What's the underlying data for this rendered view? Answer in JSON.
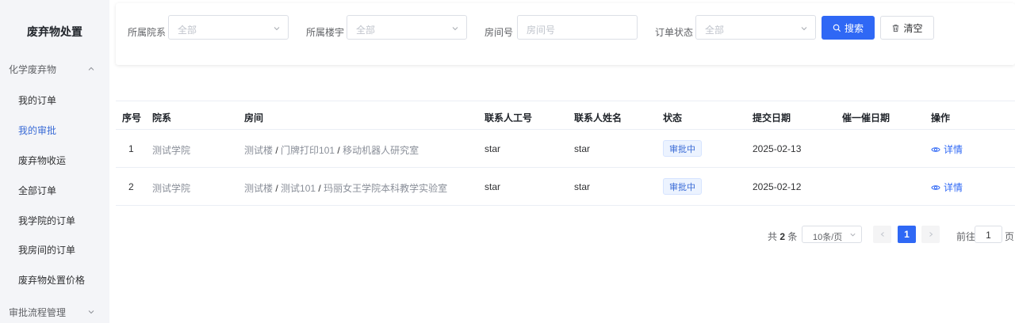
{
  "sidebar": {
    "title": "废弃物处置",
    "groups": [
      {
        "label": "化学废弃物",
        "expanded": true
      },
      {
        "label": "审批流程管理",
        "expanded": false
      }
    ],
    "items": [
      {
        "label": "我的订单"
      },
      {
        "label": "我的审批",
        "active": true
      },
      {
        "label": "废弃物收运"
      },
      {
        "label": "全部订单"
      },
      {
        "label": "我学院的订单"
      },
      {
        "label": "我房间的订单"
      },
      {
        "label": "废弃物处置价格"
      }
    ]
  },
  "filters": {
    "department": {
      "label": "所属院系",
      "placeholder": "全部"
    },
    "building": {
      "label": "所属楼宇",
      "placeholder": "全部"
    },
    "room": {
      "label": "房间号",
      "placeholder": "房间号"
    },
    "status": {
      "label": "订单状态",
      "placeholder": "全部"
    },
    "search_label": "搜索",
    "clear_label": "清空"
  },
  "table": {
    "headers": [
      "序号",
      "院系",
      "房间",
      "联系人工号",
      "联系人姓名",
      "状态",
      "提交日期",
      "催一催日期",
      "操作"
    ],
    "rows": [
      {
        "index": "1",
        "department": "测试学院",
        "room_building": "测试楼",
        "room_floor": "门牌打印101",
        "room_name": "移动机器人研究室",
        "contact_id": "star",
        "contact_name": "star",
        "status": "审批中",
        "submit_date": "2025-02-13",
        "remind_date": "",
        "action": "详情"
      },
      {
        "index": "2",
        "department": "测试学院",
        "room_building": "测试楼",
        "room_floor": "测试101",
        "room_name": "玛丽女王学院本科教学实验室",
        "contact_id": "star",
        "contact_name": "star",
        "status": "审批中",
        "submit_date": "2025-02-12",
        "remind_date": "",
        "action": "详情"
      }
    ],
    "sep": "/"
  },
  "pagination": {
    "total_prefix": "共",
    "total": "2",
    "total_suffix": "条",
    "page_size": "10条/页",
    "current_page": "1",
    "goto_prefix": "前往",
    "goto_value": "1",
    "goto_suffix": "页"
  },
  "colors": {
    "primary": "#2f68f5",
    "sidebar_active": "#3a6bd6",
    "badge_bg": "#ecf3ff"
  }
}
